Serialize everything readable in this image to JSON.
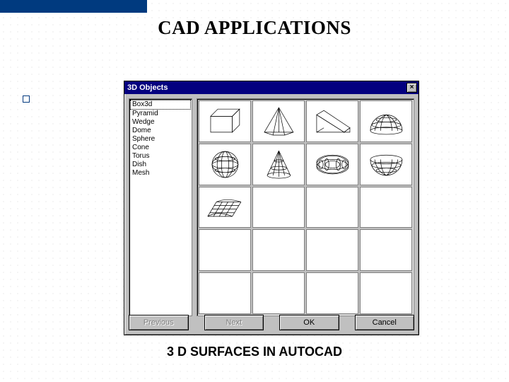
{
  "slide": {
    "title": "CAD APPLICATIONS",
    "caption": "3 D SURFACES IN AUTOCAD"
  },
  "dialog": {
    "title": "3D Objects",
    "close_glyph": "×",
    "list": {
      "items": [
        {
          "label": "Box3d",
          "selected": true
        },
        {
          "label": "Pyramid"
        },
        {
          "label": "Wedge"
        },
        {
          "label": "Dome"
        },
        {
          "label": "Sphere"
        },
        {
          "label": "Cone"
        },
        {
          "label": "Torus"
        },
        {
          "label": "Dish"
        },
        {
          "label": "Mesh"
        }
      ]
    },
    "grid": {
      "cells": [
        "box3d",
        "pyramid",
        "wedge",
        "dome",
        "sphere",
        "cone",
        "torus",
        "dish",
        "mesh",
        "blank",
        "blank",
        "blank",
        "blank",
        "blank",
        "blank",
        "blank",
        "blank",
        "blank",
        "blank",
        "blank"
      ]
    },
    "buttons": {
      "previous": "Previous",
      "next": "Next",
      "ok": "OK",
      "cancel": "Cancel"
    }
  }
}
